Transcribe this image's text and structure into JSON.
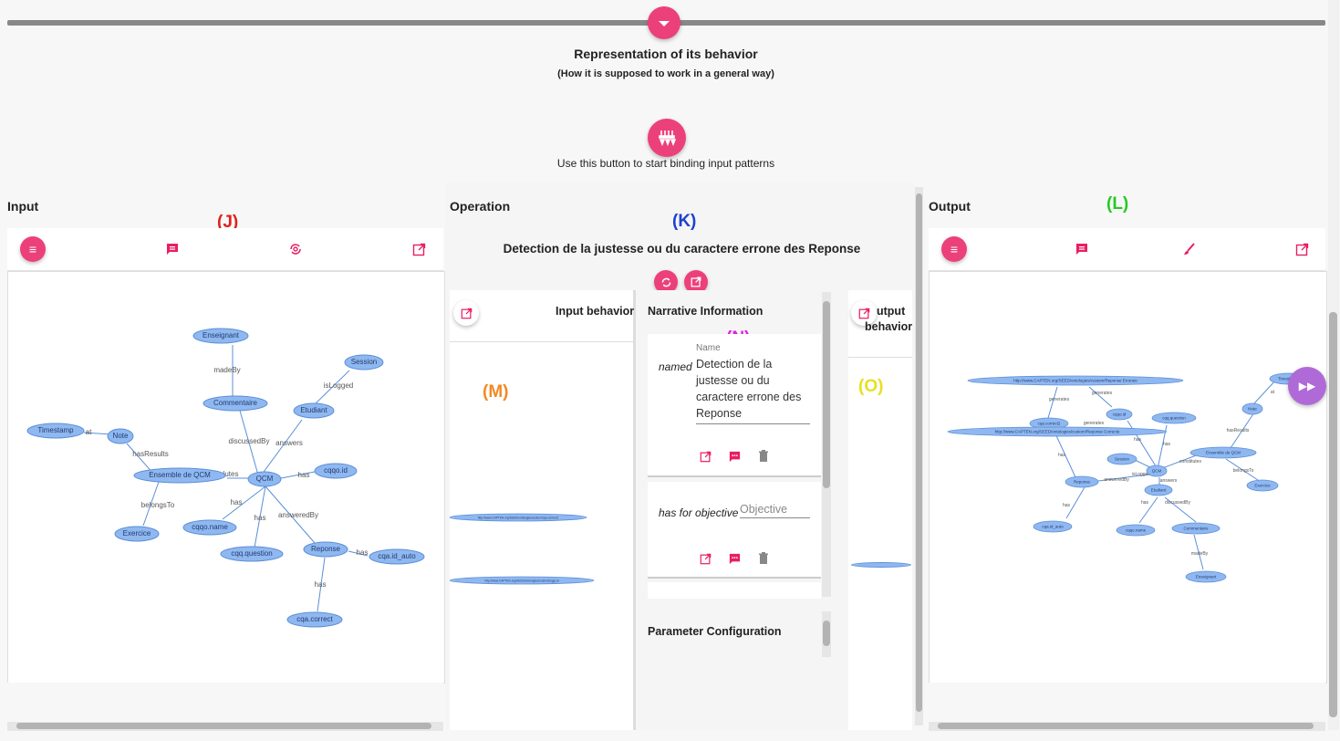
{
  "header": {
    "title": "Representation of its behavior",
    "subtitle": "(How it is supposed to work in a general way)",
    "bind_hint": "Use this button to start binding input patterns"
  },
  "markers": {
    "J": "(J)",
    "K": "(K)",
    "L": "(L)",
    "M": "(M)",
    "N": "(N)",
    "O": "(O)"
  },
  "colors": {
    "accent": "#ec407a",
    "J": "#e02020",
    "K": "#1e3fd0",
    "L": "#22cc22",
    "M": "#f08a24",
    "N": "#e020e0",
    "O": "#e8e020",
    "node": "#90b8f0",
    "node_stroke": "#5a8fd8",
    "play": "#b06ad8"
  },
  "input": {
    "heading": "Input",
    "icons": [
      "menu-icon",
      "comment-icon",
      "search-refresh-icon",
      "open-external-icon"
    ],
    "graph": {
      "nodes": [
        "Enseignant",
        "Session",
        "Commentaire",
        "Etudiant",
        "Timestamp",
        "Note",
        "Ensemble de QCM",
        "QCM",
        "cqqo.id",
        "cqqo.name",
        "Exercice",
        "cqq.question",
        "Reponse",
        "cqa.id_auto",
        "cqa.correct"
      ],
      "edge_labels": [
        "madeBy",
        "isLogged",
        "discussedBy",
        "answers",
        "at",
        "hasResults",
        "lutes",
        "has",
        "belongsTo",
        "has",
        "has",
        "answeredBy",
        "has",
        "has"
      ]
    }
  },
  "operation": {
    "heading": "Operation",
    "name": "Detection de la justesse ou du caractere errone des Reponse",
    "input_behavior": {
      "label": "Input behavior",
      "uris": [
        "http://www.CAPTEN.org/SEED/ontologies/custom/cqa.correct1",
        "http://www.CAPTEN.org/SEED/ontologies/custom/cqgo.id"
      ]
    },
    "narrative": {
      "heading": "Narrative Information",
      "name_label": "Name",
      "named_label": "named",
      "name_value": "Detection de la justesse ou du caractere errone des Reponse",
      "objective_label": "has for objective",
      "objective_placeholder": "Objective"
    },
    "parameter": {
      "heading": "Parameter Configuration"
    },
    "output_behavior": {
      "label_prefix": "utput",
      "label_suffix": "behavior"
    }
  },
  "output": {
    "heading": "Output",
    "icons": [
      "menu-icon",
      "comment-icon",
      "brush-icon",
      "open-external-icon"
    ],
    "graph": {
      "nodes": [
        "http://www.CAPTEN.org/SEED/ontologies/custom/Reponse Erronee",
        "cqa.correct2",
        "cqqo.id",
        "cqq.question",
        "http://www.CAPTEN.org/SEED/ontologies/custom/Reponse Correcte",
        "Timestamp",
        "Note",
        "Ensemble de QCM",
        "Session",
        "QCM",
        "Reponse",
        "Etudiant",
        "Exercice",
        "cqa.id_auto",
        "cqqo.name",
        "Commentaire",
        "Enseignant"
      ],
      "edge_labels": [
        "generates",
        "generates",
        "generates",
        "has",
        "has",
        "has",
        "at",
        "hasResults",
        "constitutes",
        "belongsTo",
        "isLogged",
        "answeredBy",
        "answers",
        "has",
        "has",
        "discussedBy",
        "madeBy"
      ]
    }
  }
}
